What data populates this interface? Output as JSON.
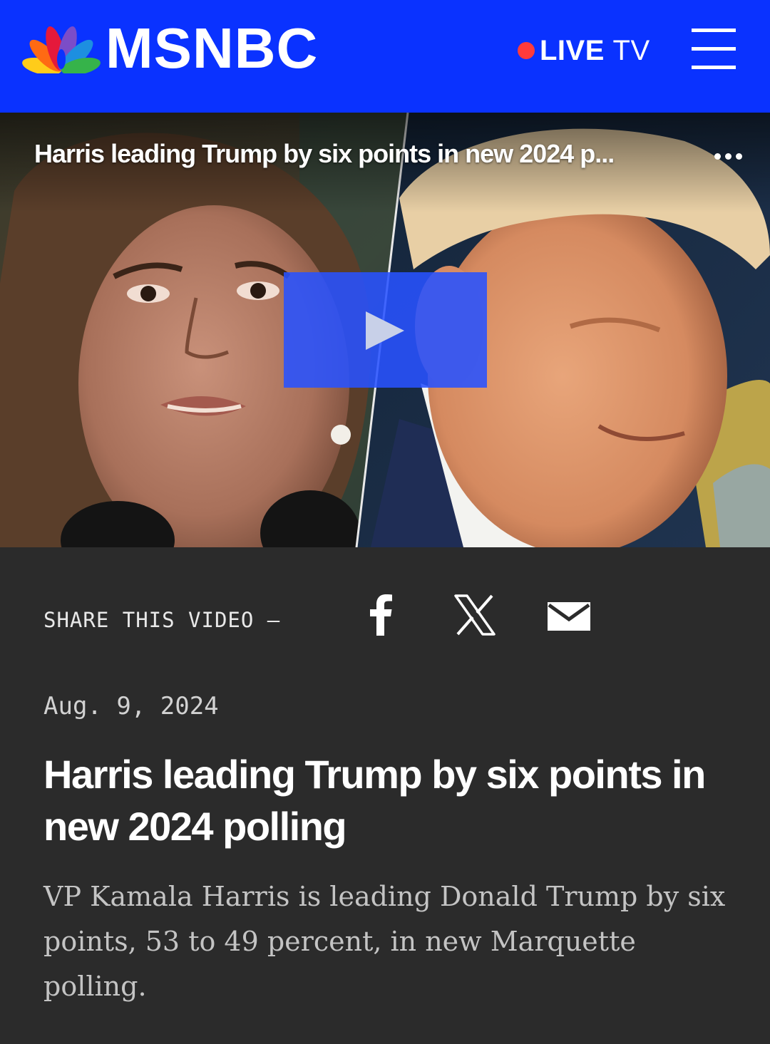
{
  "header": {
    "brand": "MSNBC",
    "live_label": "LIVE",
    "live_suffix": "TV",
    "menu_icon": "hamburger-menu-icon",
    "colors": {
      "background": "#0a32ff",
      "live_dot": "#ff3b3b"
    }
  },
  "video": {
    "title": "Harris leading Trump by six points in new 2024 p...",
    "more_icon": "more-options-icon",
    "play_icon": "play-icon",
    "play_button_color": "#2852ff"
  },
  "share": {
    "label": "SHARE THIS VIDEO —",
    "buttons": [
      {
        "icon": "facebook-icon"
      },
      {
        "icon": "x-icon"
      },
      {
        "icon": "email-icon"
      }
    ]
  },
  "article": {
    "date": "Aug. 9, 2024",
    "headline": "Harris leading Trump by six points in new 2024 polling",
    "dek": "VP Kamala Harris is leading Donald Trump by six points, 53 to 49 percent, in new Marquette polling."
  }
}
